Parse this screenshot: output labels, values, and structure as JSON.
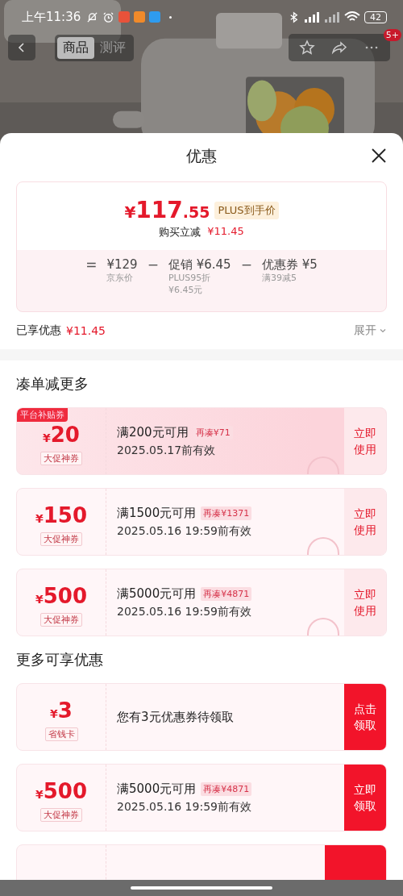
{
  "status_bar": {
    "time": "上午11:36",
    "battery": "42"
  },
  "nav": {
    "tabs": [
      {
        "label": "商品",
        "selected": true
      },
      {
        "label": "测评",
        "selected": false
      }
    ],
    "more_badge": "5+"
  },
  "sheet": {
    "title": "优惠",
    "summary": {
      "currency": "¥",
      "integer": "117",
      "decimal": ".55",
      "price_tag": "PLUS到手价",
      "saving_label": "购买立减",
      "saving_value": "¥11.45",
      "breakdown": [
        {
          "sign": "=",
          "value": "¥129",
          "notes": [
            "京东价"
          ]
        },
        {
          "sign": "−",
          "value": "促销 ¥6.45",
          "notes": [
            "PLUS95折",
            "¥6.45元"
          ]
        },
        {
          "sign": "−",
          "value": "优惠券 ¥5",
          "notes": [
            "满39减5"
          ]
        }
      ]
    },
    "enjoyed": {
      "label": "已享优惠",
      "value": "¥11.45",
      "expand": "展开"
    },
    "sections": [
      {
        "title": "凑单减更多",
        "coupons": [
          {
            "kind": "coupon",
            "highlighted": true,
            "corner_tag": "平台补贴券",
            "currency": "¥",
            "amount": "20",
            "label": "大促神券",
            "condition": "满200元可用",
            "gap": "再凑¥71",
            "validity": "2025.05.17前有效",
            "claimed": true,
            "action": "立即使用",
            "filled": false
          },
          {
            "kind": "coupon",
            "highlighted": false,
            "currency": "¥",
            "amount": "150",
            "label": "大促神券",
            "condition": "满1500元可用",
            "gap": "再凑¥1371",
            "validity": "2025.05.16 19:59前有效",
            "claimed": true,
            "action": "立即使用",
            "filled": false
          },
          {
            "kind": "coupon",
            "highlighted": false,
            "currency": "¥",
            "amount": "500",
            "label": "大促神券",
            "condition": "满5000元可用",
            "gap": "再凑¥4871",
            "validity": "2025.05.16 19:59前有效",
            "claimed": true,
            "action": "立即使用",
            "filled": false
          }
        ]
      },
      {
        "title": "更多可享优惠",
        "coupons": [
          {
            "kind": "coupon",
            "highlighted": false,
            "currency": "¥",
            "amount": "3",
            "label": "省钱卡",
            "condition": "您有3元优惠券待领取",
            "action": "点击领取",
            "filled": true
          },
          {
            "kind": "coupon",
            "highlighted": false,
            "currency": "¥",
            "amount": "500",
            "label": "大促神券",
            "condition": "满5000元可用",
            "gap": "再凑¥4871",
            "validity": "2025.05.16 19:59前有效",
            "action": "立即领取",
            "filled": true
          },
          {
            "kind": "cut",
            "filled": true
          }
        ]
      }
    ]
  }
}
